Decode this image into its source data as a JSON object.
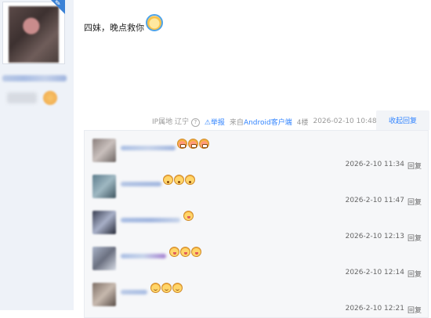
{
  "post": {
    "text": "四妹，晚点救你",
    "ip_label": "IP属地 辽宁",
    "report_label": "举报",
    "source_prefix": "来自",
    "source_client": "Android客户端",
    "floor": "4楼",
    "datetime": "2026-02-10 10:48",
    "collapse_label": "收起回复"
  },
  "replies": [
    {
      "emojis": [
        "angry",
        "angry",
        "angry"
      ],
      "time": "2026-2-10 11:34",
      "reply_label": "回复"
    },
    {
      "emojis": [
        "shock",
        "shock",
        "shock"
      ],
      "time": "2026-2-10 11:47",
      "reply_label": "回复"
    },
    {
      "emojis": [
        "tease"
      ],
      "time": "2026-2-10 12:13",
      "reply_label": "回复"
    },
    {
      "emojis": [
        "tease",
        "tease",
        "tease"
      ],
      "time": "2026-2-10 12:14",
      "reply_label": "回复"
    },
    {
      "emojis": [
        "grin",
        "grin",
        "grin"
      ],
      "time": "2026-2-10 12:21",
      "reply_label": "回复"
    }
  ],
  "colors": {
    "accent": "#3385ff",
    "sidebar_bg": "#eef2f8",
    "panel_bg": "#f6f7f9"
  }
}
